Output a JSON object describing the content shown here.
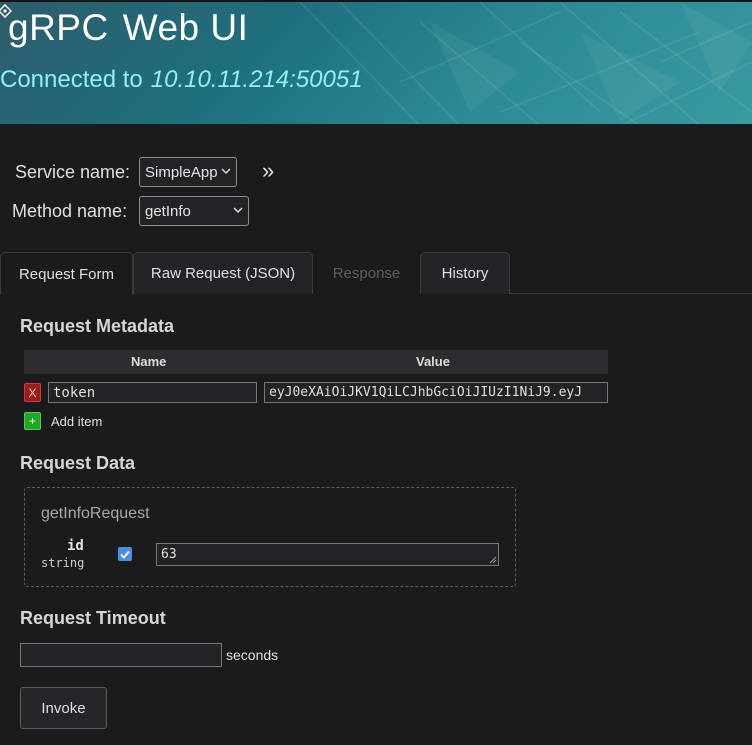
{
  "header": {
    "title_g": "gRPC",
    "title_web": "Web UI",
    "connected_label": "Connected to",
    "connected_addr": "10.10.11.214:50051"
  },
  "selectors": {
    "service_label": "Service name:",
    "service_value": "SimpleApp",
    "method_label": "Method name:",
    "method_value": "getInfo",
    "toggle_glyph": "»"
  },
  "tabs": [
    {
      "label": "Request Form",
      "state": "active"
    },
    {
      "label": "Raw Request (JSON)",
      "state": "normal"
    },
    {
      "label": "Response",
      "state": "disabled"
    },
    {
      "label": "History",
      "state": "normal"
    }
  ],
  "metadata": {
    "section_title": "Request Metadata",
    "col_name": "Name",
    "col_value": "Value",
    "rows": [
      {
        "delete_glyph": "X",
        "name": "token",
        "value": "eyJ0eXAiOiJKV1QiLCJhbGciOiJIUzI1NiJ9.eyJ"
      }
    ],
    "add_glyph": "+",
    "add_label": "Add item"
  },
  "request_data": {
    "section_title": "Request Data",
    "message_name": "getInfoRequest",
    "fields": [
      {
        "name": "id",
        "type": "string",
        "checked": true,
        "value": "63"
      }
    ]
  },
  "timeout": {
    "section_title": "Request Timeout",
    "value": "",
    "unit": "seconds"
  },
  "actions": {
    "invoke_label": "Invoke"
  },
  "colors": {
    "header_gradient_start": "#2d5c6b",
    "header_gradient_end": "#3a9aa2",
    "connected_text": "#8ff0f5",
    "delete_button": "#9a1d1d",
    "add_button": "#23a623",
    "checkbox": "#4a8ee8"
  }
}
